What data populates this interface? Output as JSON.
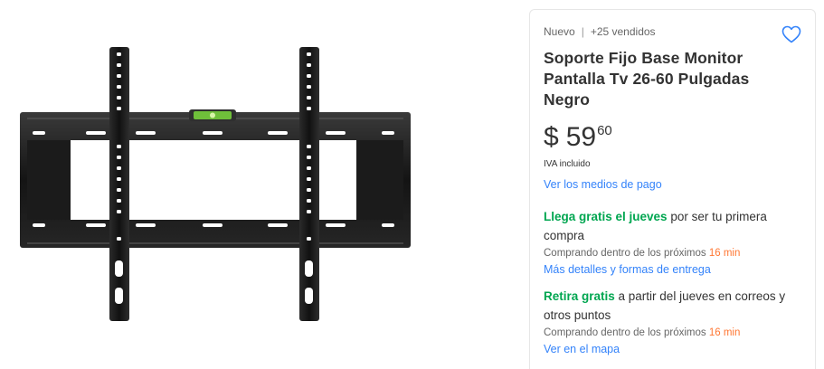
{
  "product": {
    "condition": "Nuevo",
    "sold_count": "+25 vendidos",
    "title": "Soporte Fijo Base Monitor Pantalla Tv 26-60 Pulgadas Negro",
    "favorite_icon": "heart-outline-icon",
    "image_alt": "tv-wall-mount-bracket"
  },
  "price": {
    "currency": "$",
    "integer": "59",
    "decimals": "60",
    "tax_note": "IVA incluido"
  },
  "payment": {
    "link_label": "Ver los medios de pago"
  },
  "shipping": {
    "highlight": "Llega gratis el jueves",
    "rest": " por ser tu primera compra",
    "countdown_prefix": "Comprando dentro de los próximos ",
    "countdown_value": "16 min",
    "details_link": "Más detalles y formas de entrega"
  },
  "pickup": {
    "highlight": "Retira gratis",
    "rest": " a partir del jueves en correos y otros puntos",
    "countdown_prefix": "Comprando dentro de los próximos ",
    "countdown_value": "16 min",
    "map_link": "Ver en el mapa"
  },
  "colors": {
    "accent_link": "#3483fa",
    "free_green": "#00a650",
    "countdown_orange": "#ff7733",
    "bracket_black": "#1a1a1a"
  }
}
